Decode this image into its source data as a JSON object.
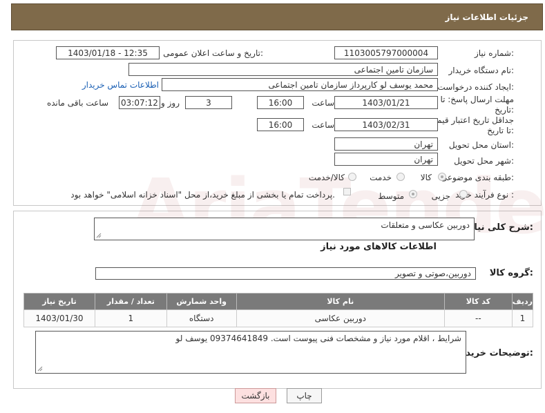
{
  "header": {
    "title": "جزئیات اطلاعات نیاز"
  },
  "fields": {
    "need_number_label": "شماره نیاز:",
    "need_number": "1103005797000004",
    "announce_label": "تاریخ و ساعت اعلان عمومی:",
    "announce_value": "1403/01/18 - 12:35",
    "buyer_org_label": "نام دستگاه خریدار:",
    "buyer_org": "سازمان تامین اجتماعی",
    "requester_label": "ایجاد کننده درخواست:",
    "requester": "محمد یوسف لو کارپرداز سازمان تامین اجتماعی",
    "contact_link": "اطلاعات تماس خریدار",
    "reply_deadline_label": "مهلت ارسال پاسخ: تا تاریخ:",
    "reply_date": "1403/01/21",
    "time_label": "ساعت",
    "reply_time": "16:00",
    "days_value": "3",
    "days_label": "روز و",
    "remaining_time": "03:07:12",
    "remaining_label": "ساعت باقی مانده",
    "price_validity_label": "جداقل تاریخ اعتبار قیمت: تا تاریخ:",
    "validity_date": "1403/02/31",
    "validity_time": "16:00",
    "province_label": "استان محل تحویل:",
    "province": "تهران",
    "city_label": "شهر محل تحویل:",
    "city": "تهران",
    "category_label": "طبقه بندی موضوعی:",
    "category_options": [
      "کالا",
      "خدمت",
      "کالا/خدمت"
    ],
    "process_label": "نوع فرآیند خرید :",
    "process_options": [
      "جزیی",
      "متوسط"
    ],
    "payment_note": "پرداخت تمام یا بخشی از مبلغ خرید،از محل \"اسناد خزانه اسلامی\" خواهد بود."
  },
  "summary": {
    "label": "شرح کلی نیاز:",
    "value": "دوربین عکاسی و متعلقات",
    "goods_info_title": "اطلاعات کالاهای مورد نیاز",
    "group_label": "گروه کالا:",
    "group_value": "دوربین،صوتی و تصویر"
  },
  "table": {
    "headers": [
      "ردیف",
      "کد کالا",
      "نام کالا",
      "واحد شمارش",
      "تعداد / مقدار",
      "تاریخ نیاز"
    ],
    "rows": [
      [
        "1",
        "--",
        "دوربین عکاسی",
        "دستگاه",
        "1",
        "1403/01/30"
      ]
    ]
  },
  "notes": {
    "label": "توضیحات خریدار:",
    "value": "شرایط ، اقلام مورد نیاز و مشخصات فنی پیوست است. 09374641849 یوسف لو"
  },
  "buttons": {
    "back": "بازگشت",
    "print": "چاپ"
  },
  "watermark": "AriaTender.neT",
  "colors": {
    "header_bg": "#7f6a4a",
    "table_header_bg": "#7a7a7a",
    "link": "#1a5fb4"
  }
}
